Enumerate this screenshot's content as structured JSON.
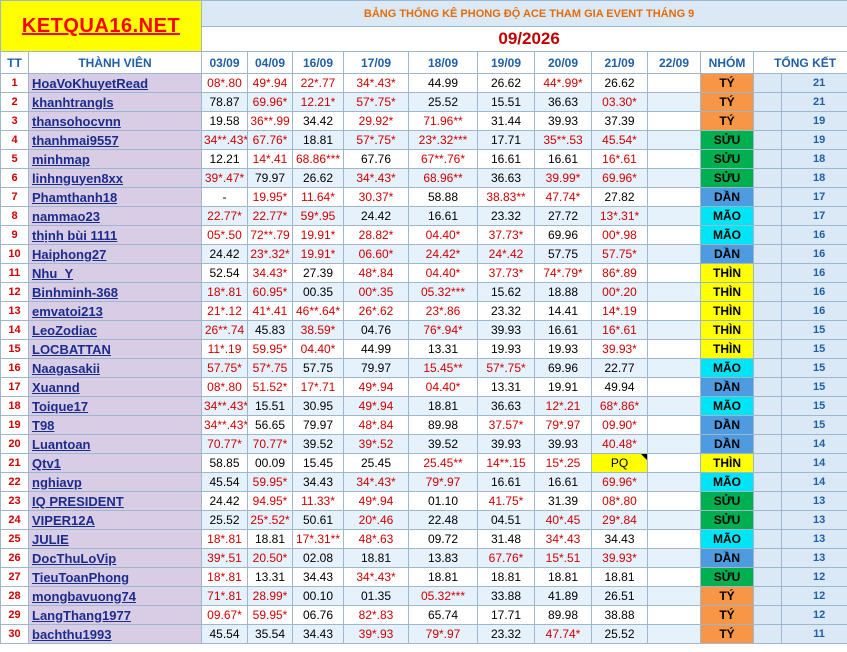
{
  "logo": "KETQUA16.NET",
  "title": "BẢNG THỐNG KÊ PHONG ĐỘ ACE THAM GIA EVENT THÁNG 9",
  "month": "09/2026",
  "headers": {
    "tt": "TT",
    "member": "THÀNH VIÊN",
    "dates": [
      "03/09",
      "04/09",
      "16/09",
      "17/09",
      "18/09",
      "19/09",
      "20/09",
      "21/09",
      "22/09"
    ],
    "group": "NHÓM",
    "total": "TỔNG KẾT"
  },
  "group_colors": {
    "TÝ": "#f79646",
    "SỬU": "#00b050",
    "DẦN": "#4e9be0",
    "MÃO": "#00e5f5",
    "THÌN": "#ffff00"
  },
  "rows": [
    {
      "tt": "1",
      "name": "HoaVoKhuyetRead",
      "cells": [
        "08*.80",
        "49*.94",
        "22*.77",
        "34*.43*",
        "44.99",
        "26.62",
        "44*.99*",
        "26.62",
        ""
      ],
      "group": "TÝ",
      "total": "21"
    },
    {
      "tt": "2",
      "name": "khanhtrangls",
      "cells": [
        "78.87",
        "69.96*",
        "12.21*",
        "57*.75*",
        "25.52",
        "15.51",
        "36.63",
        "03.30*",
        ""
      ],
      "group": "TÝ",
      "total": "21"
    },
    {
      "tt": "3",
      "name": "thansohocvnn",
      "cells": [
        "19.58",
        "36**.99",
        "34.42",
        "29.92*",
        "71.96**",
        "31.44",
        "39.93",
        "37.39",
        ""
      ],
      "group": "TÝ",
      "total": "19"
    },
    {
      "tt": "4",
      "name": "thanhmai9557",
      "cells": [
        "34**.43*",
        "67.76*",
        "18.81",
        "57*.75*",
        "23*.32***",
        "17.71",
        "35**.53",
        "45.54*",
        ""
      ],
      "group": "SỬU",
      "total": "19"
    },
    {
      "tt": "5",
      "name": "minhmap",
      "cells": [
        "12.21",
        "14*.41",
        "68.86***",
        "67.76",
        "67**.76*",
        "16.61",
        "16.61",
        "16*.61",
        ""
      ],
      "group": "SỬU",
      "total": "18"
    },
    {
      "tt": "6",
      "name": "linhnguyen8xx",
      "cells": [
        "39*.47*",
        "79.97",
        "26.62",
        "34*.43*",
        "68.96**",
        "36.63",
        "39.99*",
        "69.96*",
        ""
      ],
      "group": "SỬU",
      "total": "18"
    },
    {
      "tt": "7",
      "name": "Phamthanh18",
      "cells": [
        "-",
        "19.95*",
        "11.64*",
        "30.37*",
        "58.88",
        "38.83**",
        "47.74*",
        "27.82",
        ""
      ],
      "group": "DẦN",
      "total": "17"
    },
    {
      "tt": "8",
      "name": "nammao23",
      "cells": [
        "22.77*",
        "22.77*",
        "59*.95",
        "24.42",
        "16.61",
        "23.32",
        "27.72",
        "13*.31*",
        ""
      ],
      "group": "MÃO",
      "total": "17"
    },
    {
      "tt": "9",
      "name": "thịnh bùi 1111",
      "cells": [
        "05*.50",
        "72**.79",
        "19.91*",
        "28.82*",
        "04.40*",
        "37.73*",
        "69.96",
        "00*.98",
        ""
      ],
      "group": "MÃO",
      "total": "16"
    },
    {
      "tt": "10",
      "name": "Haiphong27",
      "cells": [
        "24.42",
        "23*.32*",
        "19.91*",
        "06.60*",
        "24.42*",
        "24*.42",
        "57.75",
        "57.75*",
        ""
      ],
      "group": "DẦN",
      "total": "16"
    },
    {
      "tt": "11",
      "name": "Nhu_Y",
      "cells": [
        "52.54",
        "34.43*",
        "27.39",
        "48*.84",
        "04.40*",
        "37.73*",
        "74*.79*",
        "86*.89",
        ""
      ],
      "group": "THÌN",
      "total": "16"
    },
    {
      "tt": "12",
      "name": "Binhminh-368",
      "cells": [
        "18*.81",
        "60.95*",
        "00.35",
        "00*.35",
        "05.32***",
        "15.62",
        "18.88",
        "00*.20",
        ""
      ],
      "group": "THÌN",
      "total": "16"
    },
    {
      "tt": "13",
      "name": "emvatoi213",
      "cells": [
        "21*.12",
        "41*.41",
        "46**.64*",
        "26*.62",
        "23*.86",
        "23.32",
        "14.41",
        "14*.19",
        ""
      ],
      "group": "THÌN",
      "total": "16"
    },
    {
      "tt": "14",
      "name": "LeoZodiac",
      "cells": [
        "26**.74",
        "45.83",
        "38.59*",
        "04.76",
        "76*.94*",
        "39.93",
        "16.61",
        "16*.61",
        ""
      ],
      "group": "THÌN",
      "total": "15"
    },
    {
      "tt": "15",
      "name": "LOCBATTAN",
      "cells": [
        "11*.19",
        "59.95*",
        "04.40*",
        "44.99",
        "13.31",
        "19.93",
        "19.93",
        "39.93*",
        ""
      ],
      "group": "THÌN",
      "total": "15"
    },
    {
      "tt": "16",
      "name": "Naagasakii",
      "cells": [
        "57.75*",
        "57*.75",
        "57.75",
        "79.97",
        "15.45**",
        "57*.75*",
        "69.96",
        "22.77",
        ""
      ],
      "group": "MÃO",
      "total": "15"
    },
    {
      "tt": "17",
      "name": "Xuannd",
      "cells": [
        "08*.80",
        "51.52*",
        "17*.71",
        "49*.94",
        "04.40*",
        "13.31",
        "19.91",
        "49.94",
        ""
      ],
      "group": "DẦN",
      "total": "15"
    },
    {
      "tt": "18",
      "name": "Toique17",
      "cells": [
        "34**.43*",
        "15.51",
        "30.95",
        "49*.94",
        "18.81",
        "36.63",
        "12*.21",
        "68*.86*",
        ""
      ],
      "group": "MÃO",
      "total": "15"
    },
    {
      "tt": "19",
      "name": "T98",
      "cells": [
        "34**.43*",
        "56.65",
        "79.97",
        "48*.84",
        "89.98",
        "37.57*",
        "79*.97",
        "09.90*",
        ""
      ],
      "group": "DẦN",
      "total": "15"
    },
    {
      "tt": "20",
      "name": "Luantoan",
      "cells": [
        "70.77*",
        "70.77*",
        "39.52",
        "39*.52",
        "39.52",
        "39.93",
        "39.93",
        "40.48*",
        ""
      ],
      "group": "DẦN",
      "total": "14"
    },
    {
      "tt": "21",
      "name": "Qtv1",
      "cells": [
        "58.85",
        "00.09",
        "15.45",
        "25.45",
        "25.45**",
        "14**.15",
        "15*.25",
        "PQ",
        ""
      ],
      "group": "THÌN",
      "total": "14"
    },
    {
      "tt": "22",
      "name": "nghiavp",
      "cells": [
        "45.54",
        "59.95*",
        "34.43",
        "34*.43*",
        "79*.97",
        "16.61",
        "16.61",
        "69.96*",
        ""
      ],
      "group": "MÃO",
      "total": "14"
    },
    {
      "tt": "23",
      "name": "IQ PRESIDENT",
      "cells": [
        "24.42",
        "94.95*",
        "11.33*",
        "49*.94",
        "01.10",
        "41.75*",
        "31.39",
        "08*.80",
        ""
      ],
      "group": "SỬU",
      "total": "13"
    },
    {
      "tt": "24",
      "name": "VIPER12A",
      "cells": [
        "25.52",
        "25*.52*",
        "50.61",
        "20*.46",
        "22.48",
        "04.51",
        "40*.45",
        "29*.84",
        ""
      ],
      "group": "SỬU",
      "total": "13"
    },
    {
      "tt": "25",
      "name": "JULIE",
      "cells": [
        "18*.81",
        "18.81",
        "17*.31**",
        "48*.63",
        "09.72",
        "31.48",
        "34*.43",
        "34.43",
        ""
      ],
      "group": "MÃO",
      "total": "13"
    },
    {
      "tt": "26",
      "name": "DocThuLoVip",
      "cells": [
        "39*.51",
        "20.50*",
        "02.08",
        "18.81",
        "13.83",
        "67.76*",
        "15*.51",
        "39.93*",
        ""
      ],
      "group": "DẦN",
      "total": "13"
    },
    {
      "tt": "27",
      "name": "TieuToanPhong",
      "cells": [
        "18*.81",
        "13.31",
        "34.43",
        "34*.43*",
        "18.81",
        "18.81",
        "18.81",
        "18.81",
        ""
      ],
      "group": "SỬU",
      "total": "12"
    },
    {
      "tt": "28",
      "name": "mongbavuong74",
      "cells": [
        "71*.81",
        "28.99*",
        "00.10",
        "01.35",
        "05.32***",
        "33.88",
        "41.89",
        "26.51",
        ""
      ],
      "group": "TÝ",
      "total": "12"
    },
    {
      "tt": "29",
      "name": "LangThang1977",
      "cells": [
        "09.67*",
        "59.95*",
        "06.76",
        "82*.83",
        "65.74",
        "17.71",
        "89.98",
        "38.88",
        ""
      ],
      "group": "TÝ",
      "total": "12"
    },
    {
      "tt": "30",
      "name": "bachthu1993",
      "cells": [
        "45.54",
        "35.54",
        "34.43",
        "39*.93",
        "79*.97",
        "23.32",
        "47.74*",
        "25.52",
        ""
      ],
      "group": "TÝ",
      "total": "11"
    }
  ]
}
